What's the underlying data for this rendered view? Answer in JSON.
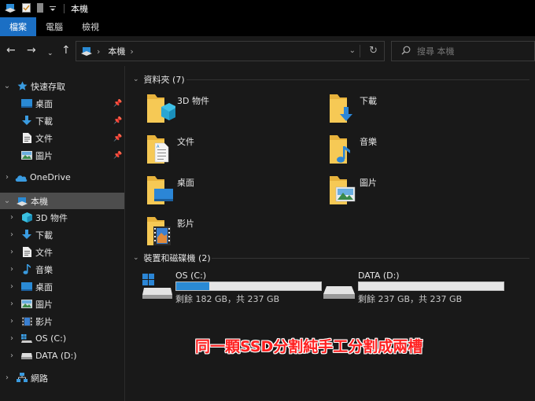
{
  "window": {
    "title": "本機"
  },
  "ribbon": {
    "tabs": [
      "檔案",
      "電腦",
      "檢視"
    ]
  },
  "address": {
    "segment": "本機",
    "chevron": "›"
  },
  "search": {
    "placeholder": "搜尋 本機"
  },
  "nav": {
    "quick_access": "快速存取",
    "quick_items": [
      "桌面",
      "下載",
      "文件",
      "圖片"
    ],
    "onedrive": "OneDrive",
    "this_pc": "本機",
    "pc_items": [
      "3D 物件",
      "下載",
      "文件",
      "音樂",
      "桌面",
      "圖片",
      "影片",
      "OS (C:)",
      "DATA (D:)"
    ],
    "network": "網路"
  },
  "content": {
    "folders_header": "資料夾 (7)",
    "folders": [
      "3D 物件",
      "下載",
      "文件",
      "音樂",
      "桌面",
      "圖片",
      "影片"
    ],
    "drives_header": "裝置和磁碟機 (2)",
    "drives": [
      {
        "name": "OS (C:)",
        "free_text": "剩餘 182 GB，共 237 GB",
        "used_fraction": 0.23
      },
      {
        "name": "DATA (D:)",
        "free_text": "剩餘 237 GB，共 237 GB",
        "used_fraction": 0.0
      }
    ]
  },
  "banner": "同一顆SSD分割純手工分割成兩槽",
  "colors": {
    "accent": "#1b6fc4",
    "drive_fill": "#2a8ad4",
    "folder": "#f3c45a",
    "banner": "#ff2020"
  }
}
